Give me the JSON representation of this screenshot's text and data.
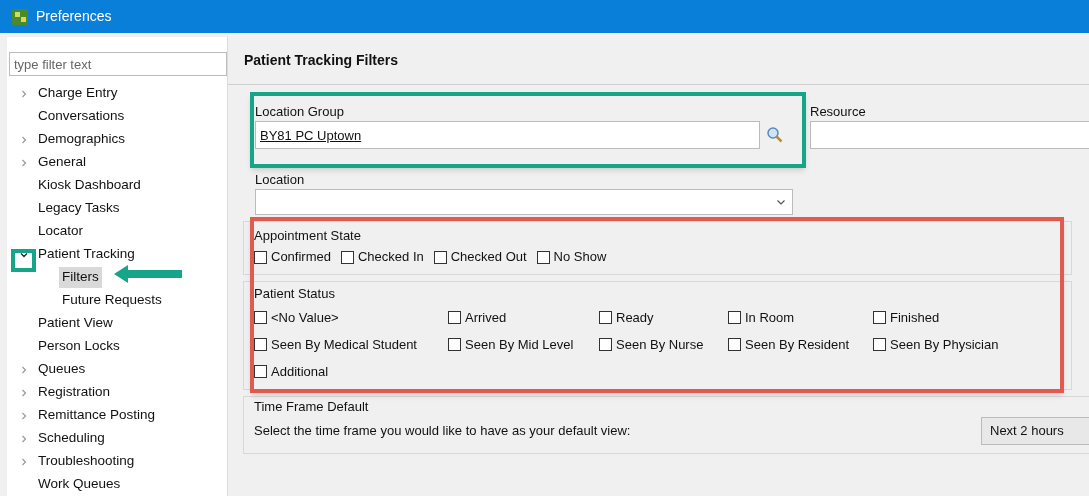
{
  "window": {
    "title": "Preferences"
  },
  "filter": {
    "placeholder": "type filter text"
  },
  "tree": [
    {
      "label": "Charge Entry",
      "kind": "branch",
      "expanded": false,
      "selected": false
    },
    {
      "label": "Conversations",
      "kind": "leaf",
      "selected": false
    },
    {
      "label": "Demographics",
      "kind": "branch",
      "expanded": false,
      "selected": false
    },
    {
      "label": "General",
      "kind": "branch",
      "expanded": false,
      "selected": false
    },
    {
      "label": "Kiosk Dashboard",
      "kind": "leaf",
      "selected": false
    },
    {
      "label": "Legacy Tasks",
      "kind": "leaf",
      "selected": false
    },
    {
      "label": "Locator",
      "kind": "leaf",
      "selected": false
    },
    {
      "label": "Patient Tracking",
      "kind": "branch",
      "expanded": true,
      "selected": false,
      "children": [
        {
          "label": "Filters",
          "selected": true
        },
        {
          "label": "Future Requests",
          "selected": false
        }
      ]
    },
    {
      "label": "Patient View",
      "kind": "leaf",
      "selected": false
    },
    {
      "label": "Person Locks",
      "kind": "leaf",
      "selected": false
    },
    {
      "label": "Queues",
      "kind": "branch",
      "expanded": false,
      "selected": false
    },
    {
      "label": "Registration",
      "kind": "branch",
      "expanded": false,
      "selected": false
    },
    {
      "label": "Remittance Posting",
      "kind": "branch",
      "expanded": false,
      "selected": false
    },
    {
      "label": "Scheduling",
      "kind": "branch",
      "expanded": false,
      "selected": false
    },
    {
      "label": "Troubleshooting",
      "kind": "branch",
      "expanded": false,
      "selected": false
    },
    {
      "label": "Work Queues",
      "kind": "leaf",
      "selected": false
    }
  ],
  "page": {
    "title": "Patient Tracking Filters",
    "location_group": {
      "label": "Location Group",
      "value": "BY81 PC Uptown"
    },
    "resource": {
      "label": "Resource"
    },
    "location": {
      "label": "Location"
    },
    "appointment_state": {
      "title": "Appointment State",
      "options": [
        {
          "label": "Confirmed",
          "checked": false
        },
        {
          "label": "Checked In",
          "checked": false
        },
        {
          "label": "Checked Out",
          "checked": false
        },
        {
          "label": "No Show",
          "checked": false
        }
      ]
    },
    "patient_status": {
      "title": "Patient Status",
      "options": [
        {
          "label": "<No Value>",
          "checked": false
        },
        {
          "label": "Arrived",
          "checked": false
        },
        {
          "label": "Ready",
          "checked": false
        },
        {
          "label": "In Room",
          "checked": false
        },
        {
          "label": "Finished",
          "checked": false
        },
        {
          "label": "Seen By Medical Student",
          "checked": false
        },
        {
          "label": "Seen By Mid Level",
          "checked": false
        },
        {
          "label": "Seen By Nurse",
          "checked": false
        },
        {
          "label": "Seen By Resident",
          "checked": false
        },
        {
          "label": "Seen By Physician",
          "checked": false
        },
        {
          "label": "Additional",
          "checked": false
        }
      ]
    },
    "time_frame": {
      "title": "Time Frame Default",
      "prompt": "Select the time frame you would like to have as your default view:",
      "value": "Next 2 hours"
    }
  }
}
